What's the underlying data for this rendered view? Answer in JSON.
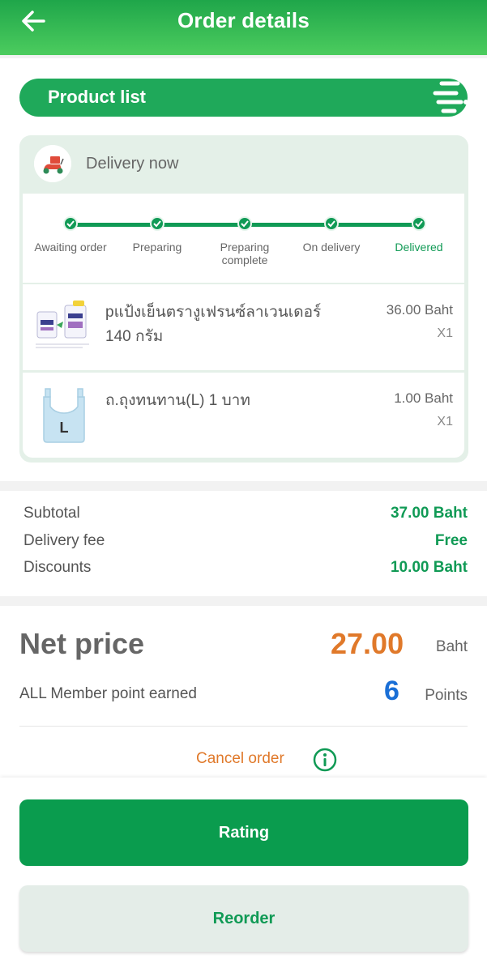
{
  "header": {
    "title": "Order details",
    "back_icon": "arrow-left-icon"
  },
  "product_list": {
    "title": "Product list"
  },
  "delivery": {
    "label": "Delivery now",
    "icon": "scooter-icon"
  },
  "tracker": {
    "steps": [
      {
        "label": "Awaiting order",
        "done": true
      },
      {
        "label": "Preparing",
        "done": true
      },
      {
        "label": "Preparing complete",
        "done": true
      },
      {
        "label": "On delivery",
        "done": true
      },
      {
        "label": "Delivered",
        "done": true,
        "active": true
      }
    ]
  },
  "items": [
    {
      "name": "pแป้งเย็นตรางูเฟรนซ์ลาเวนเดอร์ 140 กรัม",
      "price": "36.00 Baht",
      "qty": "X1"
    },
    {
      "name": "ถ.ถุงทนทาน(L) 1 บาท",
      "price": "1.00 Baht",
      "qty": "X1",
      "size_label": "L"
    }
  ],
  "summary": {
    "subtotal_label": "Subtotal",
    "subtotal_value": "37.00 Baht",
    "delivery_label": "Delivery fee",
    "delivery_value": "Free",
    "discount_label": "Discounts",
    "discount_value": "10.00 Baht"
  },
  "net": {
    "label": "Net price",
    "amount": "27.00",
    "unit": "Baht",
    "points_label": "ALL Member point earned",
    "points_value": "6",
    "points_unit": "Points"
  },
  "actions": {
    "cancel": "Cancel order",
    "rating": "Rating",
    "reorder": "Reorder"
  },
  "colors": {
    "brand_green": "#109a55",
    "accent_orange": "#e0792a",
    "points_blue": "#1a6fd6"
  }
}
